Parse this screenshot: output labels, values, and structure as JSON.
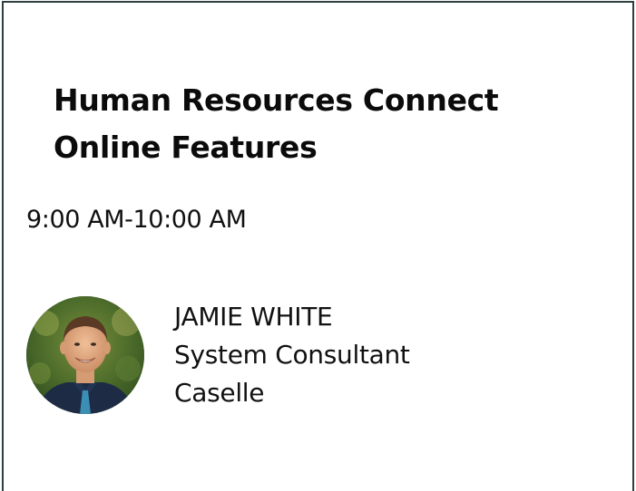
{
  "session": {
    "title_line1": "Human Resources Connect",
    "title_line2": "Online Features",
    "time": "9:00 AM-10:00 AM"
  },
  "speaker": {
    "name": "JAMIE WHITE",
    "role": "System Consultant",
    "company": "Caselle",
    "avatar_icon": "speaker-photo"
  },
  "colors": {
    "border": "#2c3e3f",
    "text": "#111111",
    "background": "#ffffff"
  }
}
